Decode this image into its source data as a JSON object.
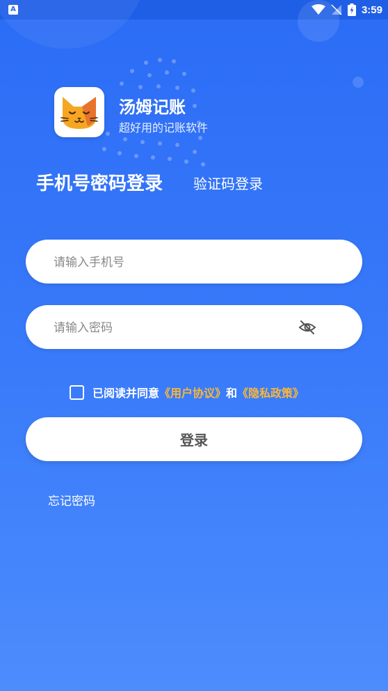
{
  "status_bar": {
    "left_icon_letter": "A",
    "time": "3:59",
    "icons": [
      "wifi-icon",
      "signal-icon",
      "battery-icon"
    ]
  },
  "app": {
    "name": "汤姆记账",
    "slogan": "超好用的记账软件",
    "logo_icon": "cat-face-icon"
  },
  "tabs": {
    "password_login": "手机号密码登录",
    "code_login": "验证码登录",
    "active": "password_login"
  },
  "form": {
    "phone_placeholder": "请输入手机号",
    "password_placeholder": "请输入密码",
    "password_toggle_icon": "eye-off-icon"
  },
  "agreement": {
    "prefix": "已阅读并同意",
    "user_agreement": "《用户协议》",
    "conjunction": "和",
    "privacy_policy": "《隐私政策》",
    "checked": false
  },
  "login_button": "登录",
  "forgot_password": "忘记密码",
  "colors": {
    "background_top": "#2b6cf6",
    "background_bottom": "#4c8cfd",
    "link_accent": "#f8b739",
    "logo_orange": "#f5a623"
  }
}
